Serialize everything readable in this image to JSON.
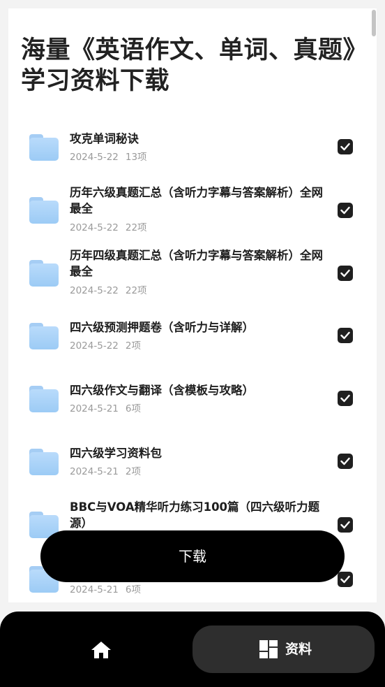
{
  "page": {
    "title": "海量《英语作文、单词、真题》学习资料下载"
  },
  "items": [
    {
      "title": "攻克单词秘诀",
      "date": "2024-5-22",
      "count": "13项",
      "checked": true
    },
    {
      "title": "历年六级真题汇总（含听力字幕与答案解析）全网最全",
      "date": "2024-5-22",
      "count": "22项",
      "checked": true
    },
    {
      "title": "历年四级真题汇总（含听力字幕与答案解析）全网最全",
      "date": "2024-5-22",
      "count": "22项",
      "checked": true
    },
    {
      "title": "四六级预测押题卷（含听力与详解）",
      "date": "2024-5-22",
      "count": "2项",
      "checked": true
    },
    {
      "title": "四六级作文与翻译（含模板与攻略）",
      "date": "2024-5-21",
      "count": "6项",
      "checked": true
    },
    {
      "title": "四六级学习资料包",
      "date": "2024-5-21",
      "count": "2项",
      "checked": true
    },
    {
      "title": "BBC与VOA精华听力练习100篇（四六级听力题源）",
      "date": "",
      "count": "",
      "checked": true
    },
    {
      "title": "",
      "date": "2024-5-21",
      "count": "6项",
      "checked": true
    }
  ],
  "download_button": {
    "label": "下载"
  },
  "bottom_nav": {
    "home_icon": "home-icon",
    "active_icon": "grid-icon",
    "active_label": "资料"
  }
}
